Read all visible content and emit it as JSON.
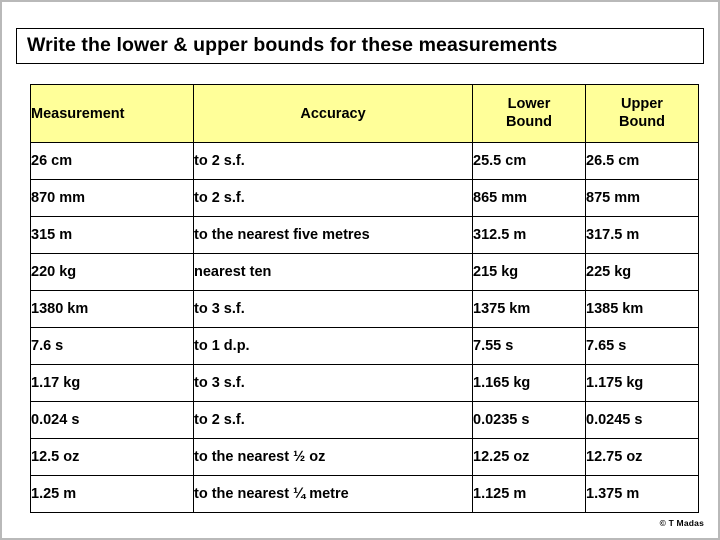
{
  "title": "Write the lower & upper bounds for these measurements",
  "colors": {
    "header_fill": "#FFFF99",
    "bound_text": "#000080",
    "border": "#000000",
    "page_border": "#B9B9B9"
  },
  "table": {
    "headers": {
      "measurement": "Measurement",
      "accuracy": "Accuracy",
      "lower_bound": "Lower\nBound",
      "lower_bound_line1": "Lower",
      "lower_bound_line2": "Bound",
      "upper_bound_line1": "Upper",
      "upper_bound_line2": "Bound"
    },
    "rows": [
      {
        "measurement": "26 cm",
        "accuracy": "to 2 s.f.",
        "lower": "25.5 cm",
        "upper": "26.5 cm"
      },
      {
        "measurement": "870 mm",
        "accuracy": "to 2 s.f.",
        "lower": "865 mm",
        "upper": "875 mm"
      },
      {
        "measurement": "315 m",
        "accuracy": "to the nearest five metres",
        "lower": "312.5 m",
        "upper": "317.5 m"
      },
      {
        "measurement": "220 kg",
        "accuracy": "nearest ten",
        "lower": "215 kg",
        "upper": "225 kg"
      },
      {
        "measurement": "1380 km",
        "accuracy": "to 3 s.f.",
        "lower": "1375 km",
        "upper": "1385 km"
      },
      {
        "measurement": "7.6 s",
        "accuracy": "to 1 d.p.",
        "lower": "7.55 s",
        "upper": "7.65 s"
      },
      {
        "measurement": "1.17 kg",
        "accuracy": "to 3 s.f.",
        "lower": "1.165 kg",
        "upper": "1.175 kg"
      },
      {
        "measurement": "0.024 s",
        "accuracy": "to 2 s.f.",
        "lower": "0.0235 s",
        "upper": "0.0245 s"
      },
      {
        "measurement": "12.5 oz",
        "accuracy": "to the nearest ½ oz",
        "lower": "12.25 oz",
        "upper": "12.75 oz"
      },
      {
        "measurement": "1.25 m",
        "accuracy": "to the nearest ¼ metre",
        "lower": "1.125 m",
        "upper": "1.375 m"
      }
    ]
  },
  "credit": "© T Madas"
}
